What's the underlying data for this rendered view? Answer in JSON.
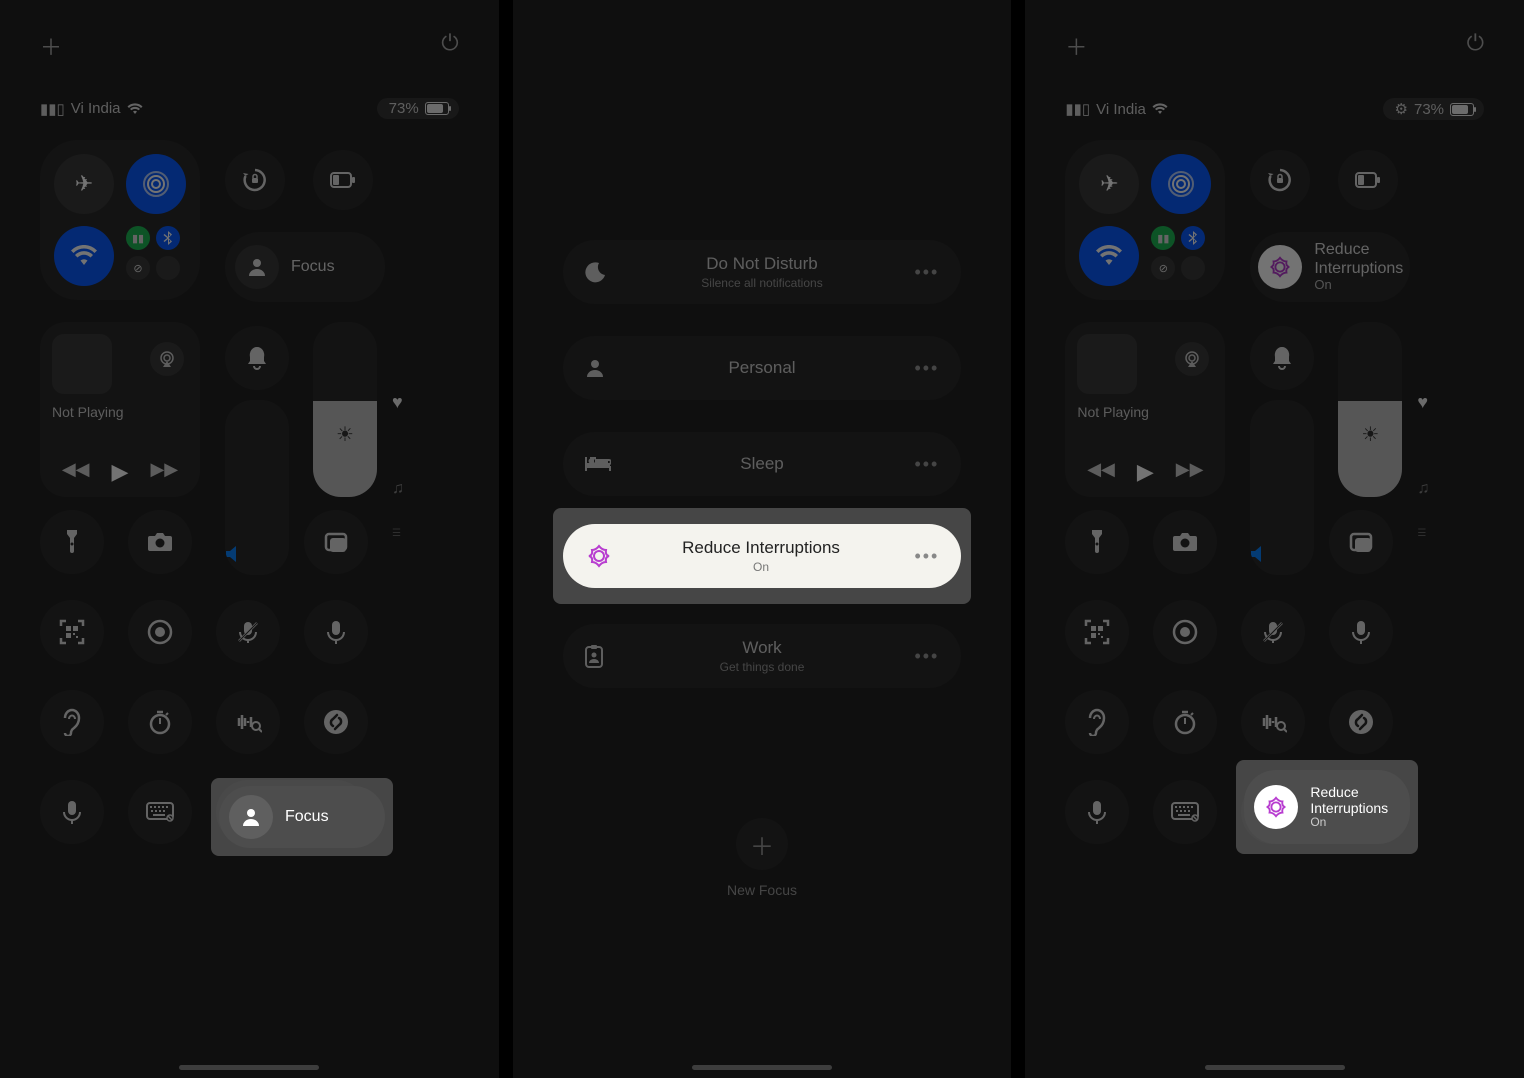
{
  "status": {
    "carrier": "Vi India",
    "battery_percent": "73%"
  },
  "controlCenter": {
    "focus_label": "Focus",
    "not_playing": "Not Playing"
  },
  "focusMenu": {
    "items": [
      {
        "title": "Do Not Disturb",
        "sub": "Silence all notifications"
      },
      {
        "title": "Personal",
        "sub": ""
      },
      {
        "title": "Sleep",
        "sub": ""
      },
      {
        "title": "Reduce Interruptions",
        "sub": "On"
      },
      {
        "title": "Work",
        "sub": "Get things done"
      }
    ],
    "new_focus_label": "New Focus"
  },
  "activeFocus": {
    "title_line1": "Reduce",
    "title_line2": "Interruptions",
    "state": "On"
  }
}
